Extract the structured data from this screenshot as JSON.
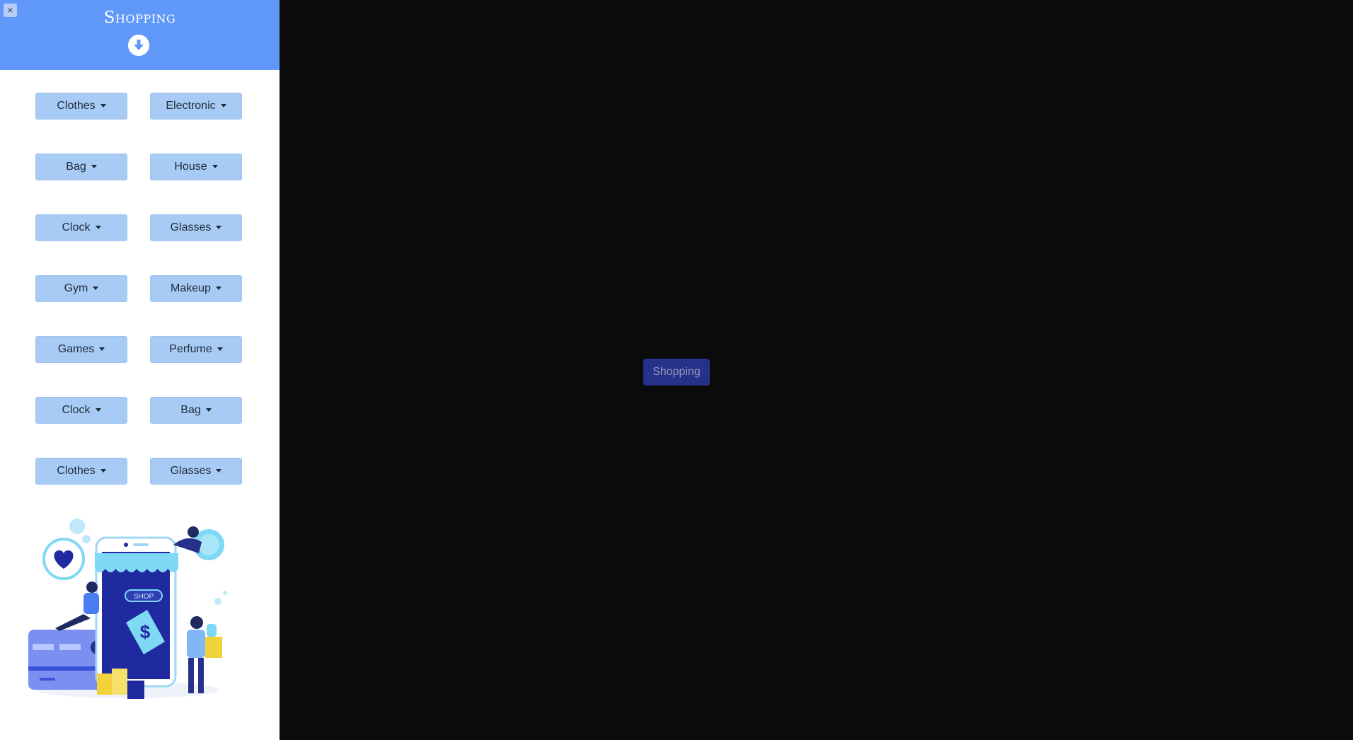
{
  "sidebar": {
    "close_label": "×",
    "title": "Shopping",
    "download_icon": "arrow-down-circle-icon",
    "categories": [
      {
        "label": "Clothes"
      },
      {
        "label": "Electronic"
      },
      {
        "label": "Bag"
      },
      {
        "label": "House"
      },
      {
        "label": "Clock"
      },
      {
        "label": "Glasses"
      },
      {
        "label": "Gym"
      },
      {
        "label": "Makeup"
      },
      {
        "label": "Games"
      },
      {
        "label": "Perfume"
      },
      {
        "label": "Clock"
      },
      {
        "label": "Bag"
      },
      {
        "label": "Clothes"
      },
      {
        "label": "Glasses"
      }
    ],
    "illustration": {
      "shop_sign": "SHOP",
      "price_symbol": "$"
    }
  },
  "main": {
    "toggle_label": "Shopping"
  },
  "colors": {
    "header": "#5f98f8",
    "category_button": "#a8cbf5",
    "background": "#0b0b0c",
    "toggle_button": "#27318a"
  }
}
